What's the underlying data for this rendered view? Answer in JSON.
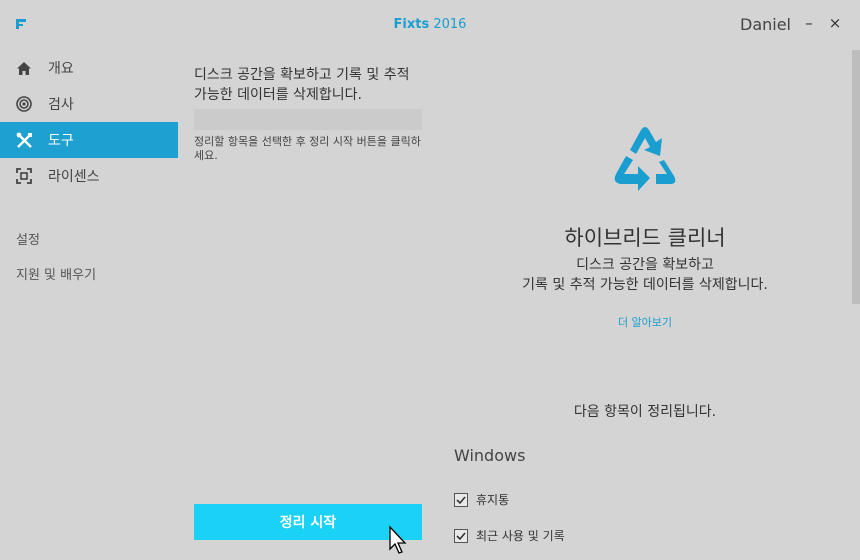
{
  "titlebar": {
    "brand": "Fixts",
    "year": "2016",
    "user": "Daniel",
    "minimize_glyph": "–",
    "close_glyph": "×"
  },
  "sidebar": {
    "items": [
      {
        "label": "개요",
        "icon": "home-icon",
        "active": false
      },
      {
        "label": "검사",
        "icon": "radar-icon",
        "active": false
      },
      {
        "label": "도구",
        "icon": "tools-icon",
        "active": true
      },
      {
        "label": "라이센스",
        "icon": "license-icon",
        "active": false
      }
    ],
    "settings": "설정",
    "support": "지원 및 배우기"
  },
  "middle": {
    "heading": "디스크 공간을 확보하고 기록 및 추적 가능한 데이터를 삭제합니다.",
    "hint": "정리할 항목을 선택한 후 정리 시작 버튼을 클릭하세요.",
    "start_button": "정리 시작"
  },
  "panel": {
    "icon": "recycle-icon",
    "title": "하이브리드 클리너",
    "desc_line1": "디스크 공간을 확보하고",
    "desc_line2": "기록 및 추적 가능한 데이터를 삭제합니다.",
    "learn_more": "더 알아보기",
    "following": "다음 항목이 정리됩니다.",
    "section": "Windows",
    "items": [
      {
        "label": "휴지통",
        "checked": true
      },
      {
        "label": "최근 사용 및 기록",
        "checked": true
      }
    ]
  },
  "colors": {
    "accent": "#1ea0d0",
    "button": "#1ad2f6",
    "background": "#d4d4d4"
  }
}
